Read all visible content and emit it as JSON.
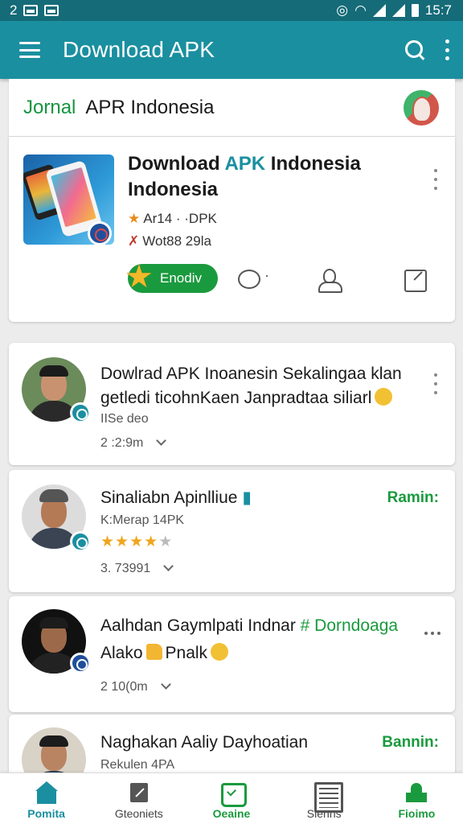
{
  "status_bar": {
    "left": "2",
    "time": "15:7"
  },
  "app_bar": {
    "title": "Download APK"
  },
  "header": {
    "brand": "Jornal",
    "title": "APR Indonesia"
  },
  "featured": {
    "title_part1": "Download",
    "title_accent": "APK",
    "title_part2": "Indonesia Indonesia",
    "meta1": "Ar14 · ·DPK",
    "meta2": "Wot88 29la",
    "get_label": "Enodiv"
  },
  "posts": [
    {
      "title_line1": "Dowlrad APK  Inoanesin Sekalingaa klan",
      "title_line2": "getledi ticohnKaen Janpradtaa siliarl",
      "sub": "IISe deo",
      "time": "2 :2:9m"
    },
    {
      "title": "Sinaliabn Apinlliue",
      "follow": "Ramin:",
      "sub": "K:Merap 14PK",
      "rating": 4,
      "time": "3. 73991"
    },
    {
      "title": "Aalhdan Gaymlpati Indnar",
      "hashtag": "# Dorndoaga",
      "line2_a": "Alako",
      "line2_b": "Pnalk",
      "time": "2 10(0m"
    },
    {
      "title": "Naghakan Aaliy Dayhoatian",
      "follow": "Bannin:",
      "sub": "Rekulen 4PA"
    }
  ],
  "bottom_nav": [
    {
      "label": "Pomita",
      "icon": "home-icon"
    },
    {
      "label": "Gteoniets",
      "icon": "edit-icon"
    },
    {
      "label": "Oeaine",
      "icon": "pentagon-check-icon"
    },
    {
      "label": "Slenns",
      "icon": "list-icon"
    },
    {
      "label": "Fioimo",
      "icon": "mosque-icon"
    }
  ],
  "colors": {
    "primary": "#1a8fa0",
    "accent_green": "#1a9a3e",
    "status_bar": "#156b78"
  }
}
